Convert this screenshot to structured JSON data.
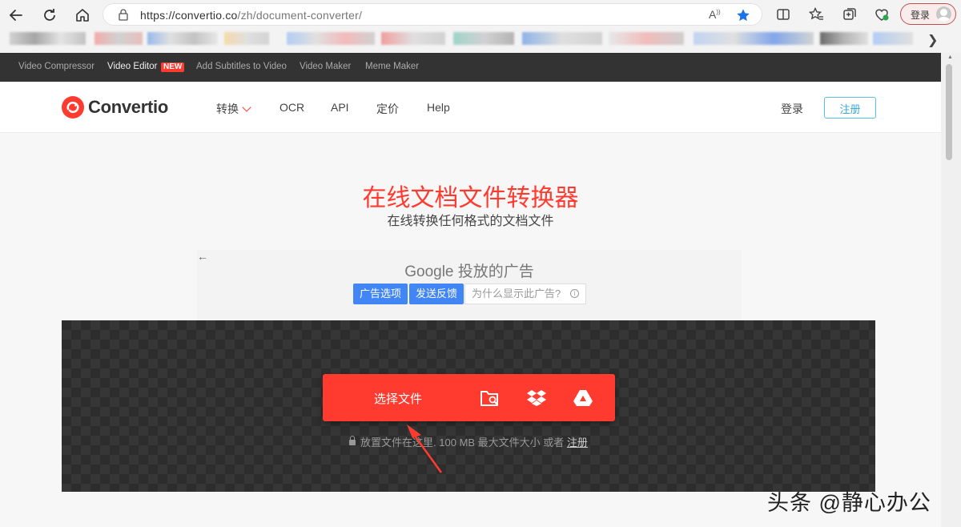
{
  "browser": {
    "url_host": "https://convertio.co",
    "url_path": "/zh/document-converter/",
    "login_label": "登录",
    "icons": [
      "back-icon",
      "reload-icon",
      "home-icon",
      "lock-icon",
      "read-aloud-icon",
      "star-icon",
      "split-screen-icon",
      "favorites-icon",
      "collections-icon",
      "extensions-icon",
      "profile-icon",
      "chevron-right-icon"
    ]
  },
  "promo": {
    "items": [
      "Video Compressor",
      "Video Editor",
      "Add Subtitles to Video",
      "Video Maker",
      "Meme Maker"
    ],
    "new_badge": "NEW"
  },
  "header": {
    "brand": "Convertio",
    "nav": [
      "转换",
      "OCR",
      "API",
      "定价",
      "Help"
    ],
    "login": "登录",
    "signup": "注册"
  },
  "hero": {
    "title": "在线文档文件转换器",
    "subtitle": "在线转换任何格式的文档文件"
  },
  "ad": {
    "title": "Google 投放的广告",
    "options_btn": "广告选项",
    "feedback_btn": "发送反馈",
    "why_text": "为什么显示此广告?",
    "info_glyph": "i"
  },
  "dropzone": {
    "choose_label": "选择文件",
    "note": "放置文件在这里. 100 MB 最大文件大小 或者",
    "note_link": "注册"
  },
  "watermark": "头条 @静心办公",
  "colors": {
    "brand_red": "#ff3b30",
    "promo_bg": "#333333",
    "signup_border": "#5bc0de",
    "ad_blue": "#4285f4"
  }
}
